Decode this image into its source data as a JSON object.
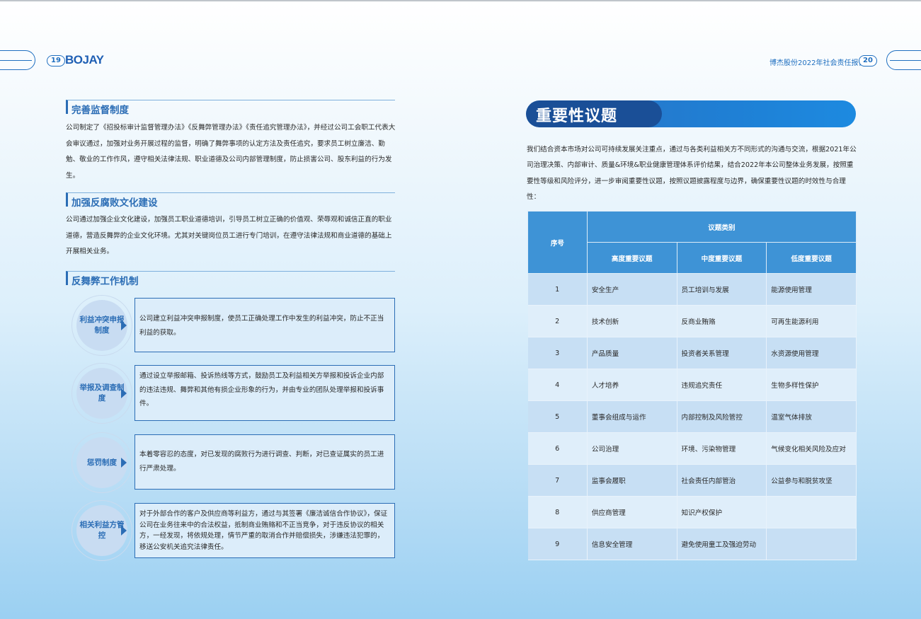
{
  "header": {
    "left_page_num": "19",
    "logo_text": "BOJAY",
    "right_title": "博杰股份2022年社会责任报告",
    "right_page_num": "20"
  },
  "left": {
    "sections": [
      {
        "heading": "完善监督制度",
        "text": "公司制定了《招投标审计监督管理办法》《反舞弊管理办法》《责任追究管理办法》，并经过公司工会职工代表大会审议通过，加强对业务开展过程的监督，明确了舞弊事项的认定方法及责任追究，要求员工树立廉洁、勤勉、敬业的工作作风，遵守相关法律法规、职业道德及公司内部管理制度，防止损害公司、股东利益的行为发生。"
      },
      {
        "heading": "加强反腐败文化建设",
        "text": "公司通过加强企业文化建设，加强员工职业道德培训，引导员工树立正确的价值观、荣辱观和诚信正直的职业道德，营造反舞弊的企业文化环境。尤其对关键岗位员工进行专门培训，在遵守法律法规和商业道德的基础上开展相关业务。"
      },
      {
        "heading": "反舞弊工作机制"
      }
    ],
    "mechanisms": [
      {
        "label": "利益冲突申报制度",
        "text": "公司建立利益冲突申报制度，使员工正确处理工作中发生的利益冲突，防止不正当利益的获取。"
      },
      {
        "label": "举报及调查制度",
        "text": "通过设立举报邮箱、投诉热线等方式，鼓励员工及利益相关方举报和投诉企业内部的违法违规、舞弊和其他有损企业形象的行为，并由专业的团队处理举报和投诉事件。"
      },
      {
        "label": "惩罚制度",
        "text": "本着零容忍的态度，对已发现的腐败行为进行调查、判断，对已查证属实的员工进行严肃处理。"
      },
      {
        "label": "相关利益方管控",
        "text": "对于外部合作的客户及供应商等利益方，通过与其签署《廉洁诚信合作协议》，保证公司在业务往来中的合法权益，抵制商业贿赂和不正当竞争，对于违反协议的相关方，一经发现，将依规处理，情节严重的取消合作并赔偿损失，涉嫌违法犯罪的，移送公安机关追究法律责任。"
      }
    ]
  },
  "right": {
    "banner_title": "重要性议题",
    "intro": "我们结合资本市场对公司可持续发展关注重点，通过与各类利益相关方不同形式的沟通与交流，根据2021年公司治理决策、内部审计、质量&环境&职业健康管理体系评价结果，结合2022年本公司整体业务发展，按照重要性等级和风险评分，进一步审阅重要性议题，按照议题披露程度与边界，确保重要性议题的时效性与合理性：",
    "table": {
      "col_seq": "序号",
      "col_group": "议题类别",
      "col_high": "高度重要议题",
      "col_mid": "中度重要议题",
      "col_low": "低度重要议题",
      "rows": [
        {
          "num": "1",
          "high": "安全生产",
          "mid": "员工培训与发展",
          "low": "能源使用管理"
        },
        {
          "num": "2",
          "high": "技术创新",
          "mid": "反商业贿赂",
          "low": "可再生能源利用"
        },
        {
          "num": "3",
          "high": "产品质量",
          "mid": "投资者关系管理",
          "low": "水资源使用管理"
        },
        {
          "num": "4",
          "high": "人才培养",
          "mid": "违规追究责任",
          "low": "生物多样性保护"
        },
        {
          "num": "5",
          "high": "董事会组成与运作",
          "mid": "内部控制及风险管控",
          "low": "温室气体排放"
        },
        {
          "num": "6",
          "high": "公司治理",
          "mid": "环境、污染物管理",
          "low": "气候变化相关风险及应对"
        },
        {
          "num": "7",
          "high": "监事会履职",
          "mid": "社会责任内部管治",
          "low": "公益参与和脱贫攻坚"
        },
        {
          "num": "8",
          "high": "供应商管理",
          "mid": "知识产权保护",
          "low": ""
        },
        {
          "num": "9",
          "high": "信息安全管理",
          "mid": "避免使用童工及强迫劳动",
          "low": ""
        }
      ]
    }
  }
}
